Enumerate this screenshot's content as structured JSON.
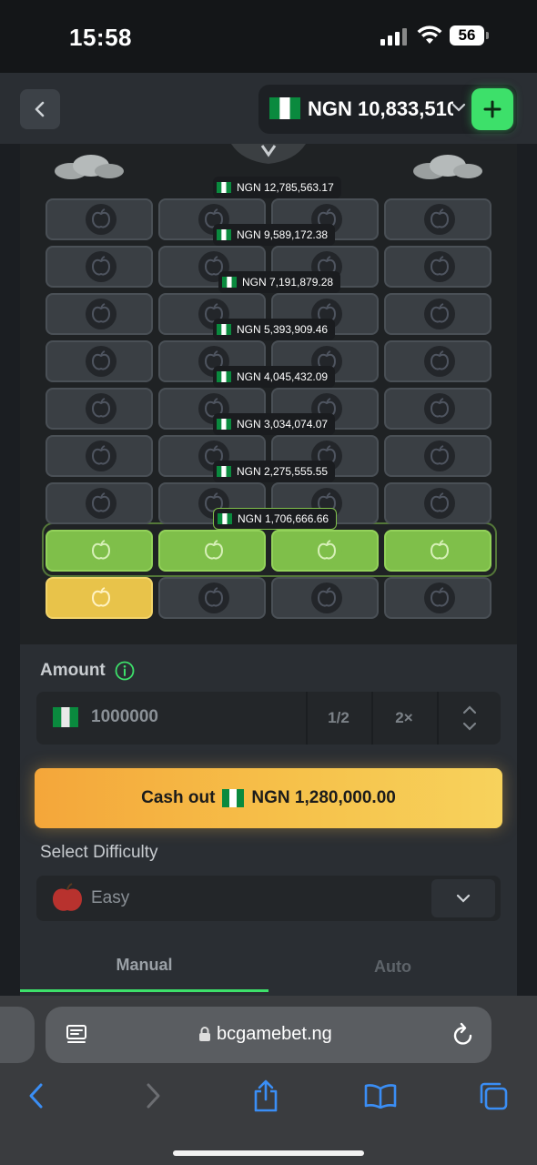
{
  "status_bar": {
    "time": "15:58",
    "battery": "56"
  },
  "header": {
    "balance": "NGN 10,833,510",
    "currency_flag": "nigeria-flag"
  },
  "game": {
    "multipliers": [
      "NGN 12,785,563.17",
      "NGN 9,589,172.38",
      "NGN 7,191,879.28",
      "NGN 5,393,909.46",
      "NGN 4,045,432.09",
      "NGN 3,034,074.07",
      "NGN 2,275,555.55",
      "NGN 1,706,666.66"
    ],
    "rows": 9,
    "columns": 4,
    "revealed_row_state": "green",
    "picked_tile": {
      "row": 9,
      "col": 1,
      "state": "gold"
    },
    "colors": {
      "green": "#7fbf4a",
      "gold": "#e8c34a",
      "tile": "#3a3f44"
    }
  },
  "controls": {
    "amount_label": "Amount",
    "amount_value": "1000000",
    "half_label": "1/2",
    "double_label": "2×",
    "cashout_prefix": "Cash out",
    "cashout_amount": "NGN 1,280,000.00",
    "difficulty_label": "Select Difficulty",
    "difficulty_value": "Easy",
    "tab_manual": "Manual",
    "tab_auto": "Auto",
    "accent_color": "#3de06a"
  },
  "browser": {
    "url": "bcgamebet.ng"
  }
}
